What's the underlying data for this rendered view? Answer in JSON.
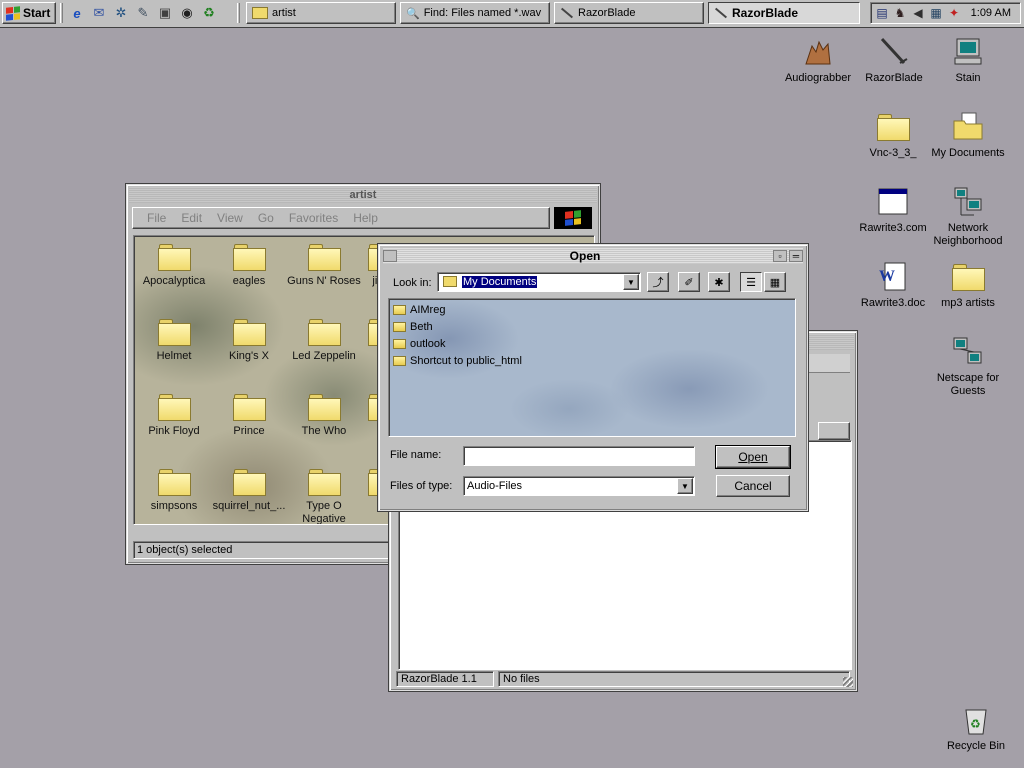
{
  "taskbar": {
    "start_label": "Start",
    "quick_launch": [
      "internet-explorer-icon",
      "outlook-icon",
      "network-icon",
      "notepad-icon",
      "desktop-icon",
      "winamp-icon",
      "channels-icon"
    ],
    "tasks": [
      {
        "label": "artist",
        "icon": "folder-icon",
        "active": false
      },
      {
        "label": "Find: Files named *.wav",
        "icon": "find-icon",
        "active": false
      },
      {
        "label": "RazorBlade",
        "icon": "razor-icon",
        "active": false
      },
      {
        "label": "RazorBlade",
        "icon": "razor-icon",
        "active": true
      }
    ],
    "tray_icons": [
      "monitor-icon",
      "cow-icon",
      "speaker-icon",
      "network-tray-icon",
      "mail-tray-icon"
    ],
    "clock": "1:09 AM"
  },
  "desktop": {
    "icons": [
      {
        "label": "Audiograbber",
        "icon": "audiograbber-icon"
      },
      {
        "label": "RazorBlade",
        "icon": "razorblade-icon"
      },
      {
        "label": "Stain",
        "icon": "computer-icon"
      },
      {
        "label": "Vnc-3_3_",
        "icon": "folder-icon"
      },
      {
        "label": "My Documents",
        "icon": "my-documents-icon"
      },
      {
        "label": "Rawrite3.com",
        "icon": "program-icon"
      },
      {
        "label": "Network Neighborhood",
        "icon": "network-neighborhood-icon"
      },
      {
        "label": "Rawrite3.doc",
        "icon": "word-document-icon"
      },
      {
        "label": "mp3 artists",
        "icon": "folder-icon"
      },
      {
        "label": "Netscape for Guests",
        "icon": "netscape-icon"
      },
      {
        "label": "Recycle Bin",
        "icon": "recycle-bin-icon"
      }
    ]
  },
  "artist_window": {
    "title": "artist",
    "menu": [
      "File",
      "Edit",
      "View",
      "Go",
      "Favorites",
      "Help"
    ],
    "folders": [
      "Apocalyptica",
      "eagles",
      "Guns N' Roses",
      "jimm",
      "Helmet",
      "King's X",
      "Led Zeppelin",
      "Ra",
      "Pink Floyd",
      "Prince",
      "The Who",
      "m",
      "simpsons",
      "squirrel_nut_...",
      "Type O Negative",
      "Va"
    ],
    "status": "1 object(s) selected"
  },
  "razor_window": {
    "status_left": "RazorBlade 1.1",
    "status_right": "No files"
  },
  "open_dialog": {
    "title": "Open",
    "look_in_label": "Look in:",
    "look_in_value": "My Documents",
    "files": [
      {
        "name": "AIMreg",
        "icon": "folder-icon"
      },
      {
        "name": "Beth",
        "icon": "folder-icon"
      },
      {
        "name": "outlook",
        "icon": "folder-icon"
      },
      {
        "name": "Shortcut to public_html",
        "icon": "shortcut-folder-icon"
      }
    ],
    "file_name_label": "File name:",
    "file_name_value": "",
    "files_of_type_label": "Files of type:",
    "files_of_type_value": "Audio-Files",
    "open_label": "Open",
    "cancel_label": "Cancel"
  }
}
